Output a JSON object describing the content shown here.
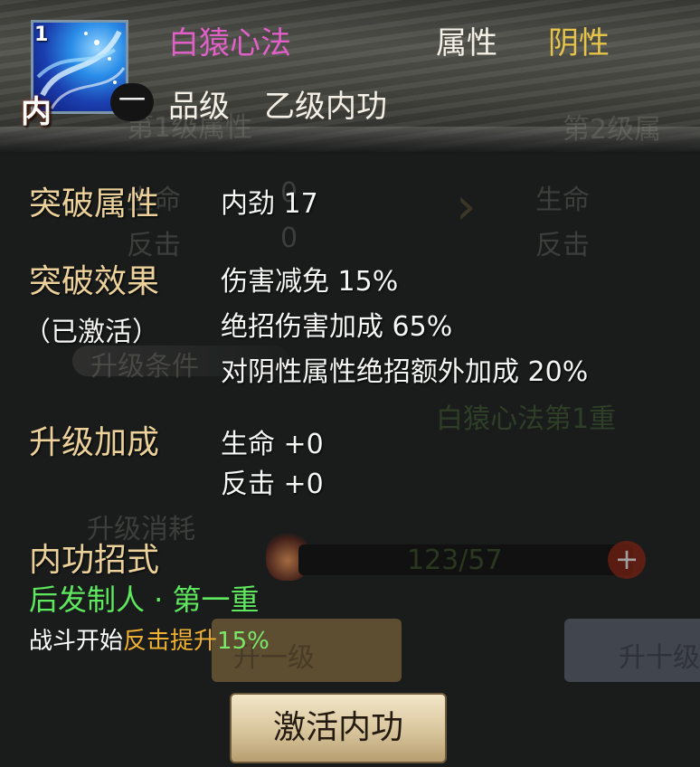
{
  "skill": {
    "icon_level": "1",
    "icon_tag": "内",
    "tier_badge": "一",
    "name": "白猿心法",
    "attribute_label": "属性",
    "attribute_value": "阴性",
    "grade_label": "品级",
    "grade_value": "乙级内功"
  },
  "breakthrough_attr": {
    "title": "突破属性",
    "value": "内劲 17"
  },
  "breakthrough_effect": {
    "title": "突破效果",
    "status": "（已激活）",
    "lines": [
      "伤害减免 15%",
      "绝招伤害加成 65%",
      "对阴性属性绝招额外加成 20%"
    ]
  },
  "upgrade_bonus": {
    "title": "升级加成",
    "lines": [
      "生命 +0",
      "反击 +0"
    ]
  },
  "moves": {
    "title": "内功招式",
    "name": "后发制人 · 第一重",
    "desc_prefix": "战斗开始",
    "desc_highlight": "反击提升",
    "desc_value": "15%"
  },
  "activate_button": "激活内功",
  "background": {
    "level1": "第1级属性",
    "level2": "第2级属",
    "life_left": "生命",
    "counter_left": "反击",
    "zero1": "0",
    "zero2": "0",
    "life_right": "生命",
    "counter_right": "反击",
    "upgrade_cond": "升级条件",
    "req_name": "白猿心法第1重",
    "upgrade_cost": "升级消耗",
    "cost_value": "123/57",
    "btn_one": "升一级",
    "btn_ten": "升十级"
  },
  "colors": {
    "title": "#e060c8",
    "attribute": "#e6c44a",
    "section": "#ecd29a",
    "move_name": "#5ee85e",
    "highlight": "#f0b030"
  }
}
